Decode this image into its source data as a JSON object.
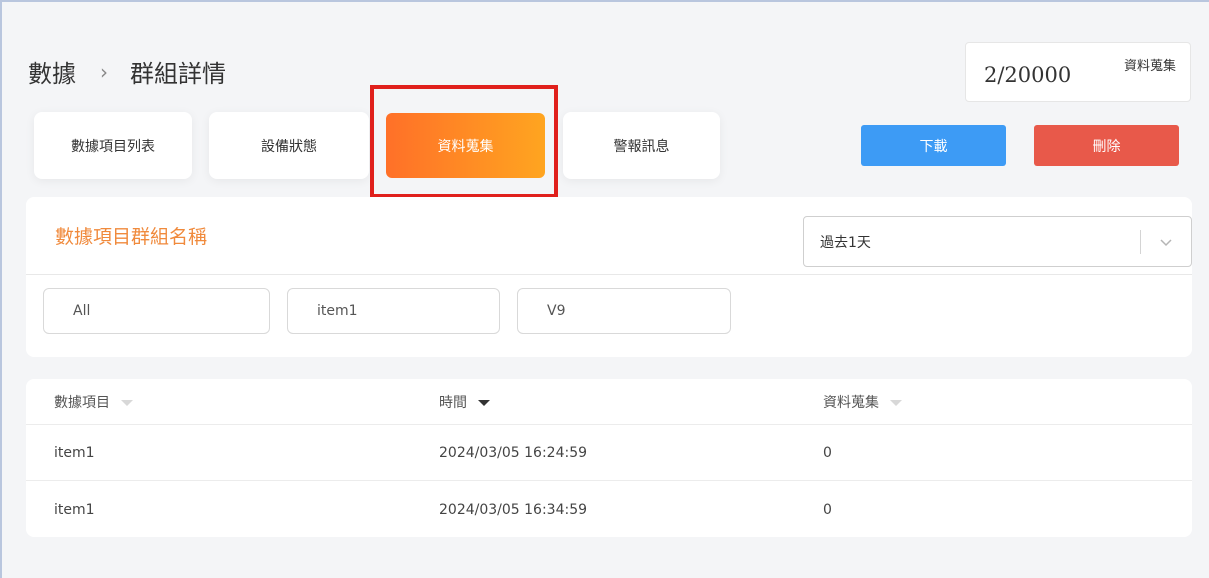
{
  "breadcrumb": {
    "root": "數據",
    "separator": "›",
    "current": "群組詳情"
  },
  "quota": {
    "value": "2/20000",
    "label": "資料蒐集"
  },
  "tabs": [
    {
      "label": "數據項目列表",
      "active": false
    },
    {
      "label": "設備狀態",
      "active": false
    },
    {
      "label": "資料蒐集",
      "active": true
    },
    {
      "label": "警報訊息",
      "active": false
    }
  ],
  "actions": {
    "download_label": "下載",
    "delete_label": "刪除"
  },
  "filter": {
    "group_title": "數據項目群組名稱",
    "time_range": "過去1天",
    "chips": [
      "All",
      "item1",
      "V9"
    ]
  },
  "table": {
    "columns": [
      {
        "label": "數據項目",
        "sort": "none"
      },
      {
        "label": "時間",
        "sort": "desc"
      },
      {
        "label": "資料蒐集",
        "sort": "none"
      }
    ],
    "rows": [
      [
        "item1",
        "2024/03/05 16:24:59",
        "0"
      ],
      [
        "item1",
        "2024/03/05 16:34:59",
        "0"
      ]
    ]
  },
  "colors": {
    "accent_gradient_start": "#ff7028",
    "accent_gradient_end": "#ffa520",
    "download": "#3d9bf5",
    "delete": "#e8594a",
    "highlight": "#e0201c",
    "title": "#f08a3c"
  }
}
